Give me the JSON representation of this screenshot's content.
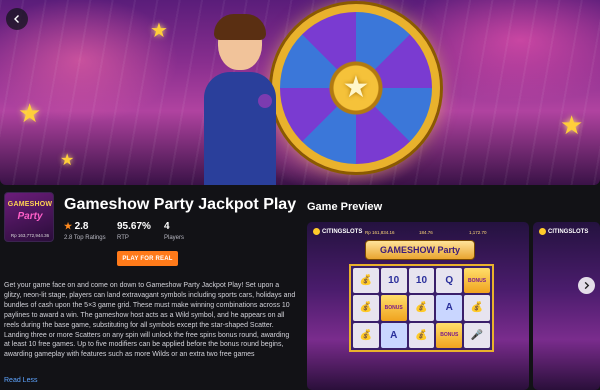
{
  "hero": {
    "back_icon": "arrow-left-icon"
  },
  "game": {
    "thumbnail": {
      "title_top": "GAMESHOW",
      "title_bottom": "Party",
      "jackpot": "Rp 163,772,944.36"
    },
    "title": "Gameshow Party Jackpot Play",
    "rating": {
      "value": "2.8",
      "label": "2.8 Top Ratings"
    },
    "rtp": {
      "value": "95.67%",
      "label": "RTP"
    },
    "players": {
      "value": "4",
      "label": "Players"
    },
    "play_button": "PLAY FOR REAL",
    "description": "Get your game face on and come on down to Gameshow Party Jackpot Play! Set upon a glitzy, neon-lit stage, players can land extravagant symbols including sports cars, holidays and bundles of cash upon the 5×3 game grid. These must make winning combinations across 10 paylines to award a win. The gameshow host acts as a Wild symbol, and he appears on all reels during the base game, substituting for all symbols except the star-shaped Scatter. Landing three or more Scatters on any spin will unlock the free spins bonus round, awarding at least 10 free games. Up to five modifiers can be applied before the bonus round begins, awarding gameplay with features such as more Wilds or an extra two free games",
    "read_less": "Read Less"
  },
  "preview": {
    "title": "Game Preview",
    "shots": [
      {
        "brand": "CITINGSLOTS",
        "balances": [
          "Rp 161,834.16",
          "184.76",
          "1,172.70"
        ],
        "logo": "GAMESHOW Party"
      },
      {
        "brand": "CITINGSLOTS"
      }
    ],
    "next_icon": "chevron-right-icon"
  },
  "colors": {
    "accent": "#ff7a1a",
    "link": "#5ea4ff",
    "background": "#121216"
  }
}
